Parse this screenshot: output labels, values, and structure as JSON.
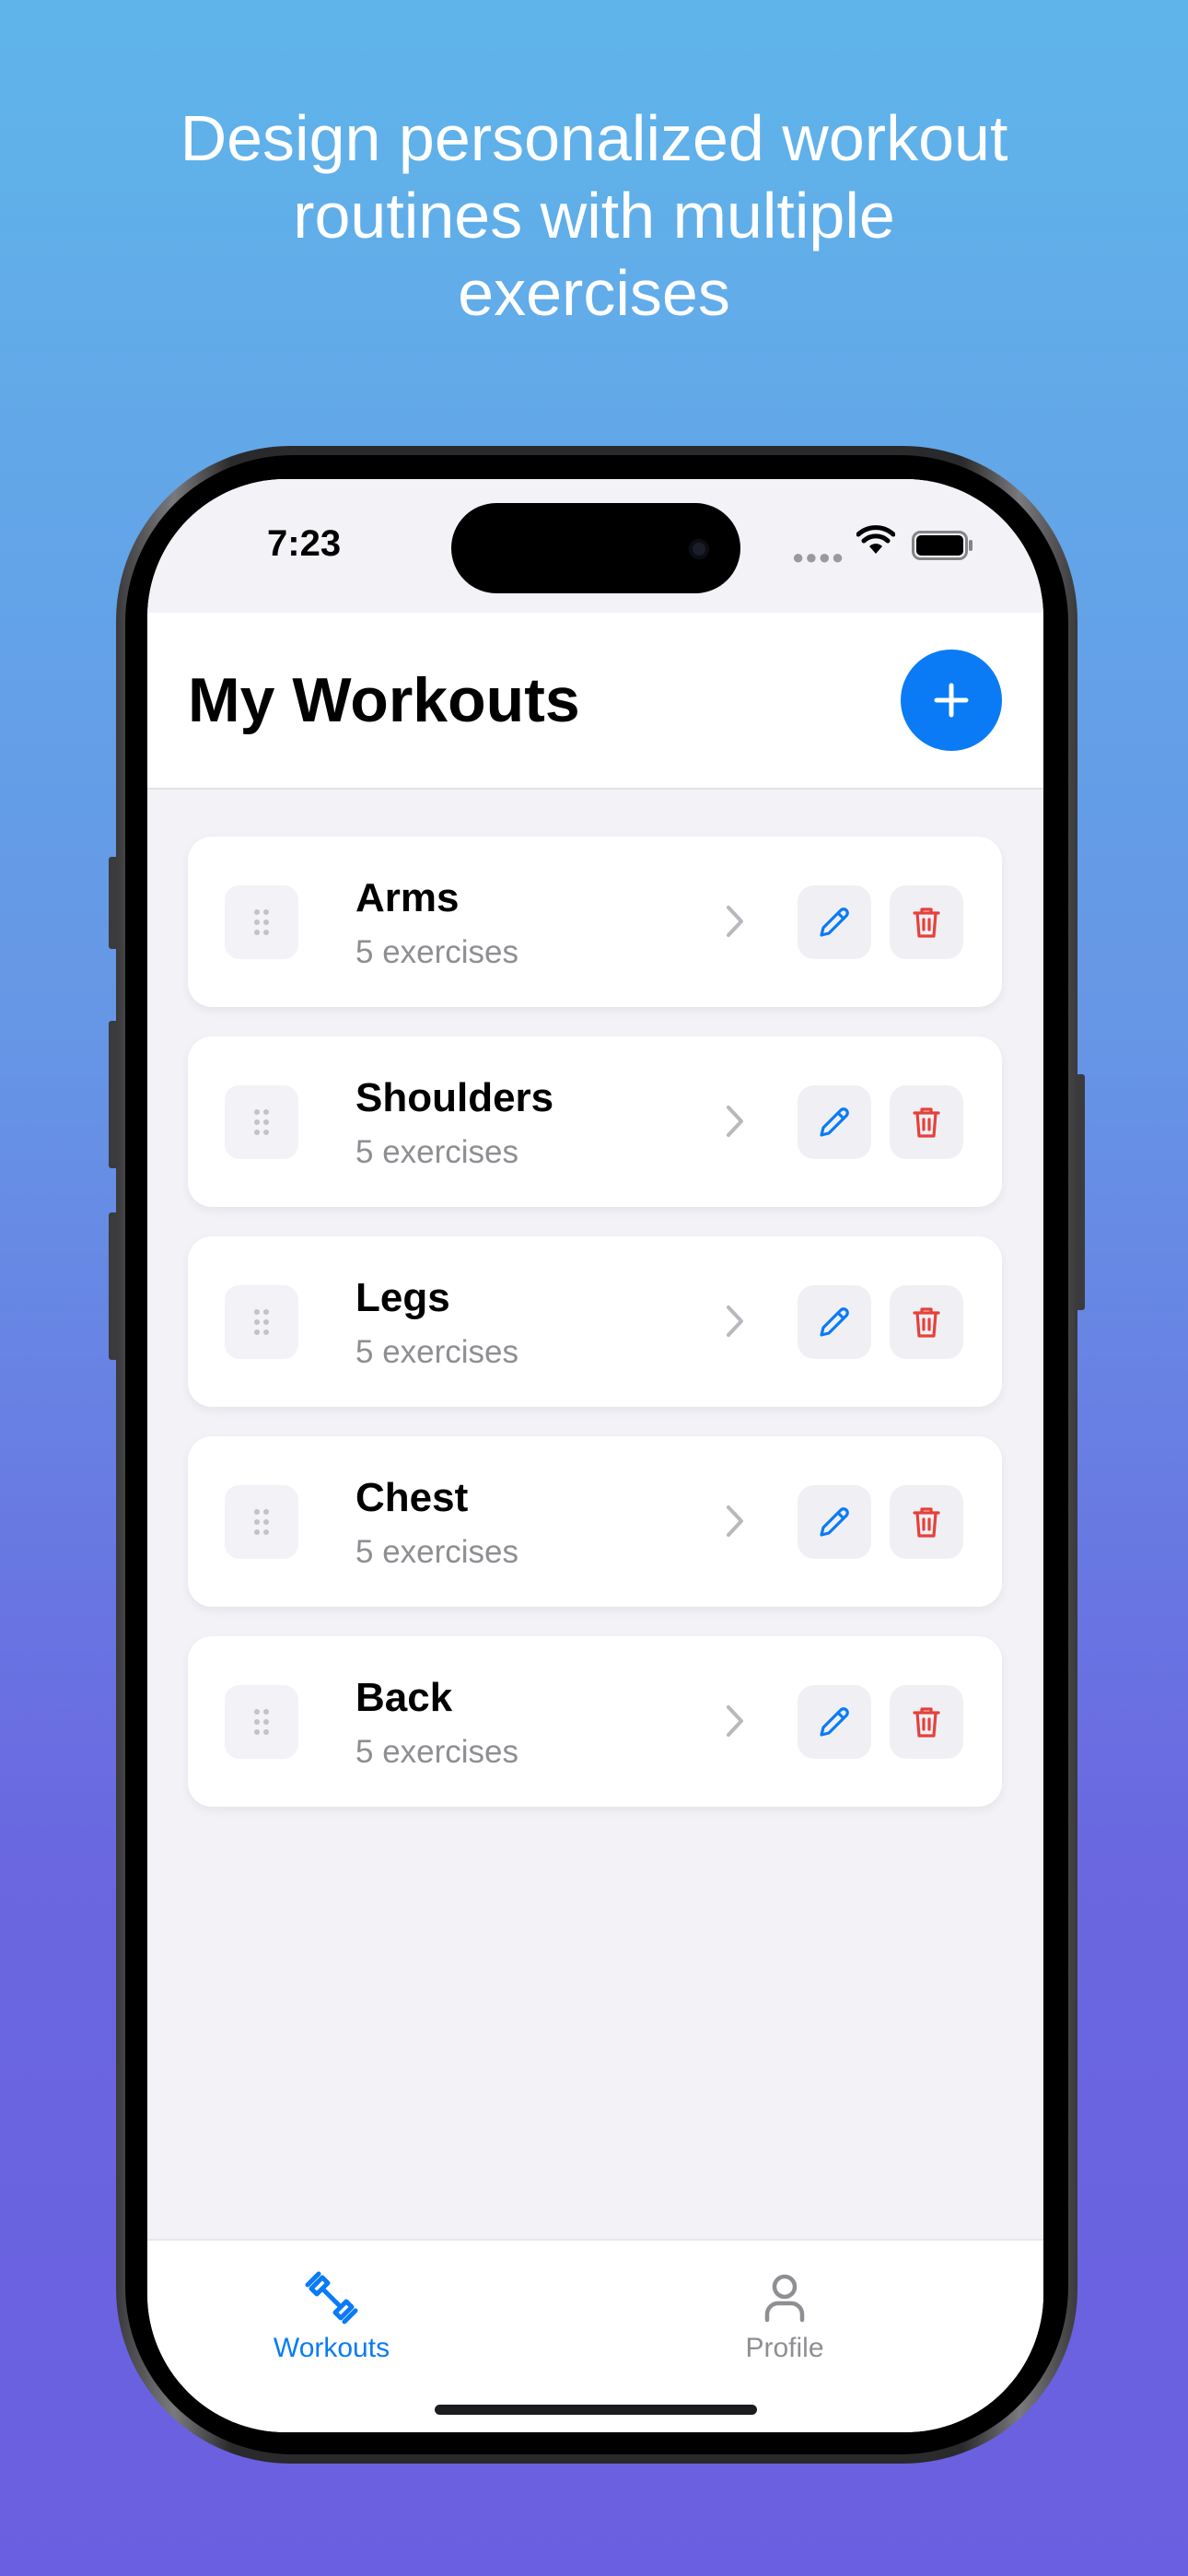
{
  "headline": {
    "line1": "Design personalized workout",
    "line2": "routines with multiple",
    "line3": "exercises"
  },
  "status_bar": {
    "time": "7:23"
  },
  "header": {
    "title": "My Workouts",
    "add_icon": "plus-icon"
  },
  "workouts": [
    {
      "name": "Arms",
      "count": "5 exercises"
    },
    {
      "name": "Shoulders",
      "count": "5 exercises"
    },
    {
      "name": "Legs",
      "count": "5 exercises"
    },
    {
      "name": "Chest",
      "count": "5 exercises"
    },
    {
      "name": "Back",
      "count": "5 exercises"
    }
  ],
  "tab_bar": {
    "tabs": [
      {
        "label": "Workouts",
        "icon": "dumbbell-icon",
        "active": true
      },
      {
        "label": "Profile",
        "icon": "person-icon",
        "active": false
      }
    ]
  },
  "colors": {
    "accent": "#0a7bf5",
    "delete": "#e5413b",
    "secondary_text": "#8e8e93",
    "background": "#f2f2f7"
  }
}
